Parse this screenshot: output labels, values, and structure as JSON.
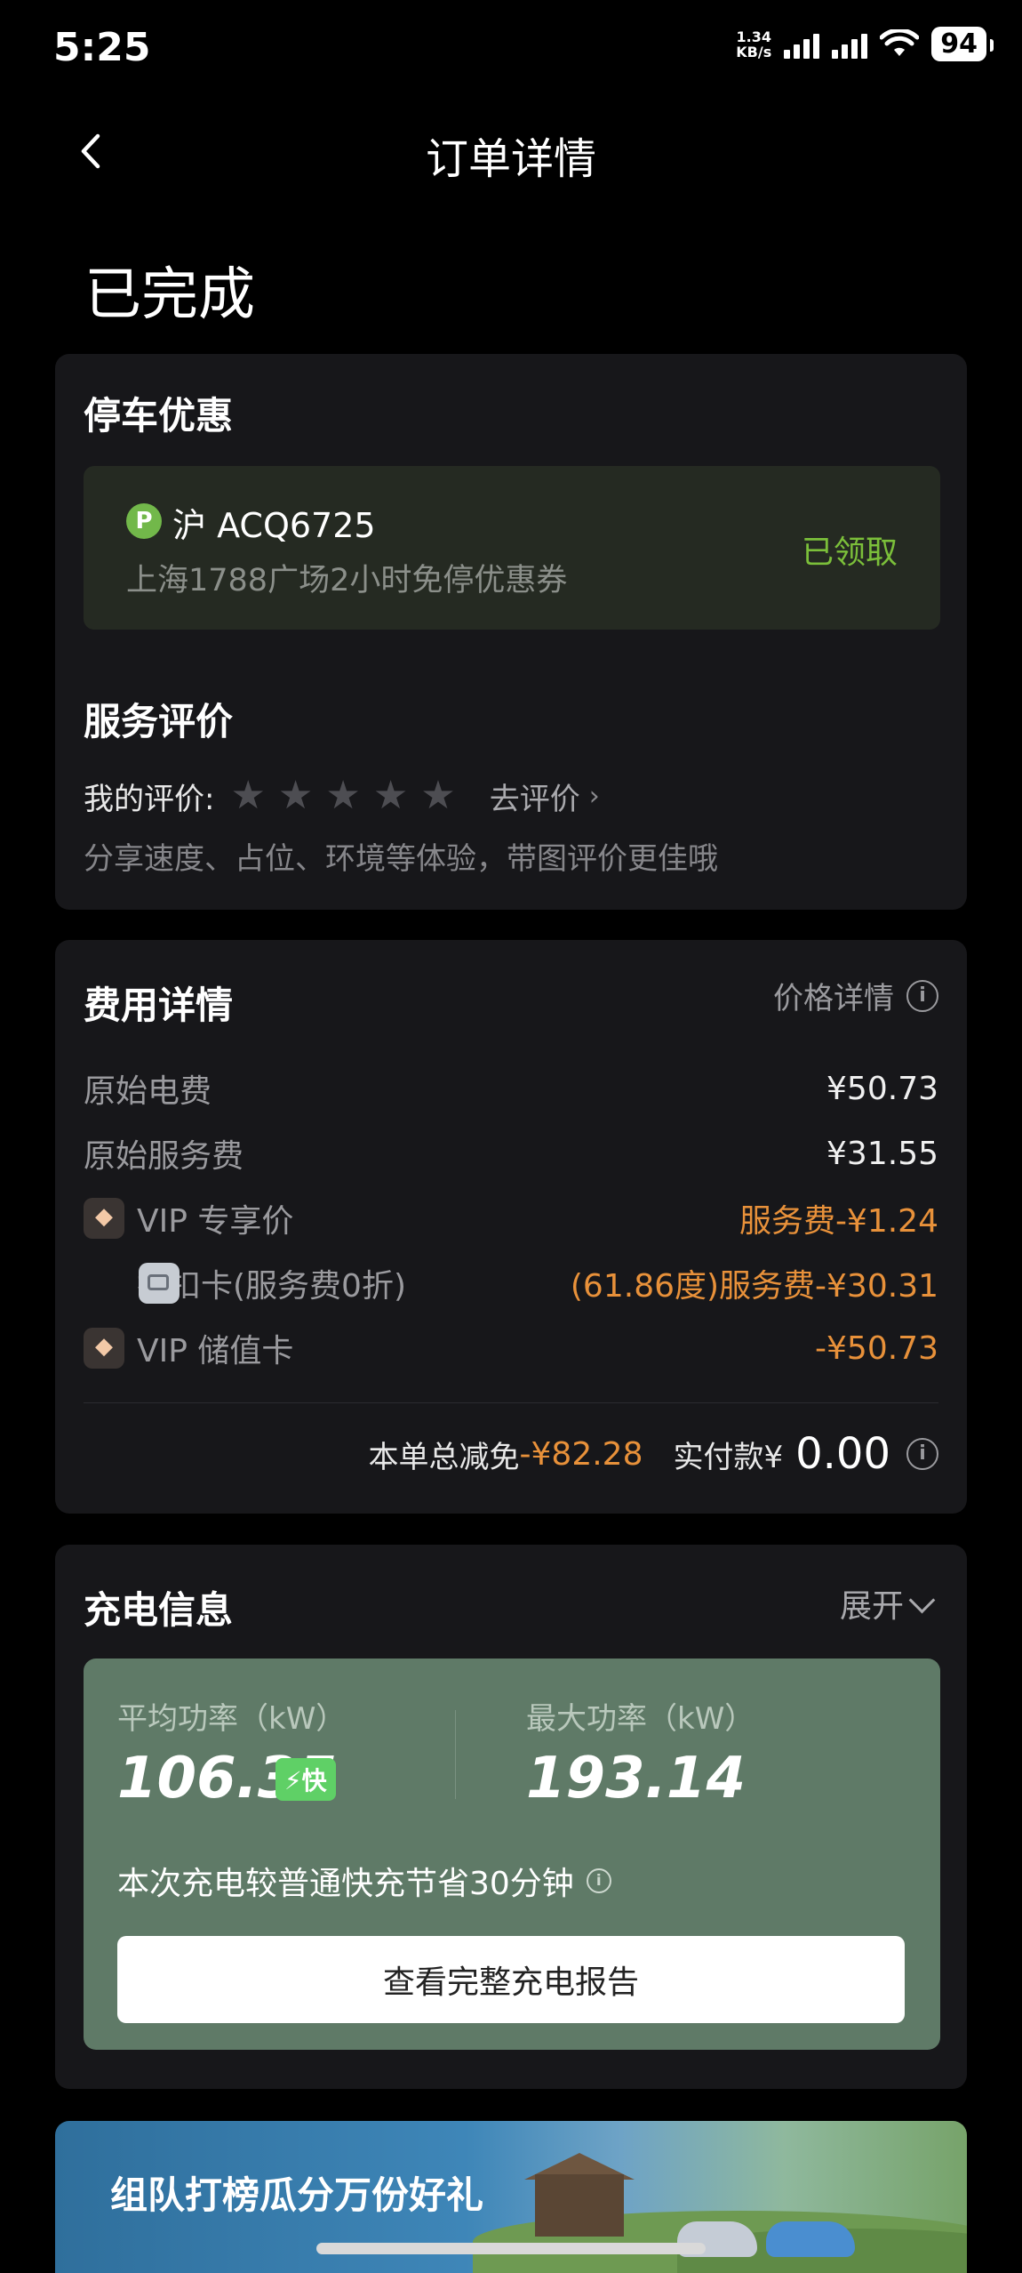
{
  "status_bar": {
    "time": "5:25",
    "net_speed_value": "1.34",
    "net_speed_unit": "KB/s",
    "battery": "94"
  },
  "nav": {
    "title": "订单详情",
    "back_icon": "chevron-left-icon"
  },
  "order_status": "已完成",
  "parking": {
    "title": "停车优惠",
    "badge": "P",
    "plate": "沪 ACQ6725",
    "coupon_desc": "上海1788广场2小时免停优惠券",
    "status": "已领取"
  },
  "review": {
    "title": "服务评价",
    "my_rating_label": "我的评价:",
    "stars_total": 5,
    "stars_filled": 0,
    "go_rate": "去评价",
    "hint": "分享速度、占位、环境等体验，带图评价更佳哦"
  },
  "fees": {
    "title": "费用详情",
    "price_detail": "价格详情",
    "rows": [
      {
        "label": "原始电费",
        "value": "¥50.73",
        "icon": null
      },
      {
        "label": "原始服务费",
        "value": "¥31.55",
        "icon": null
      },
      {
        "label": "VIP 专享价",
        "value": "服务费-¥1.24",
        "icon": "vip-diamond-icon"
      },
      {
        "label": "折扣卡(服务费0折)",
        "value": "(61.86度)服务费-¥30.31",
        "icon": "discount-card-icon"
      },
      {
        "label": "VIP 储值卡",
        "value": "-¥50.73",
        "icon": "vip-diamond-icon"
      }
    ],
    "total_discount_label": "本单总减免",
    "total_discount": "-¥82.28",
    "paid_label": "实付款¥",
    "paid_amount": "0.00"
  },
  "charging": {
    "title": "充电信息",
    "expand_label": "展开",
    "avg_power_label": "平均功率（kW）",
    "avg_power": "106.35",
    "fast_badge": "⚡快",
    "max_power_label": "最大功率（kW）",
    "max_power": "193.14",
    "save_note": "本次充电较普通快充节省30分钟",
    "report_button": "查看完整充电报告"
  },
  "banner": {
    "text": "组队打榜瓜分万份好礼"
  },
  "colors": {
    "background": "#000000",
    "card": "#17171a",
    "accent_orange": "#e8913a",
    "claimed_green": "#7bbf3a",
    "charge_panel": "#5f7a67",
    "fast_badge": "#5fd066"
  }
}
